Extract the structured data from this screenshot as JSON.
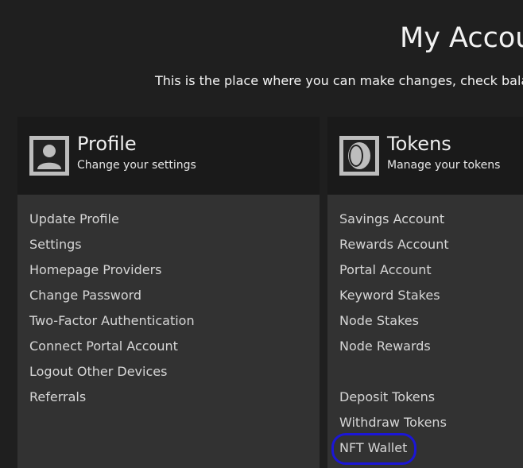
{
  "page": {
    "title": "My Account",
    "subtitle": "This is the place where you can make changes, check balances"
  },
  "profile_card": {
    "icon": "user-icon",
    "title": "Profile",
    "subtitle": "Change your settings",
    "links": [
      {
        "label": "Update Profile"
      },
      {
        "label": "Settings"
      },
      {
        "label": "Homepage Providers"
      },
      {
        "label": "Change Password"
      },
      {
        "label": "Two-Factor Authentication"
      },
      {
        "label": "Connect Portal Account"
      },
      {
        "label": "Logout Other Devices"
      },
      {
        "label": "Referrals"
      }
    ]
  },
  "tokens_card": {
    "icon": "token-icon",
    "title": "Tokens",
    "subtitle": "Manage your tokens",
    "links": [
      {
        "label": "Savings Account"
      },
      {
        "label": "Rewards Account"
      },
      {
        "label": "Portal Account"
      },
      {
        "label": "Keyword Stakes"
      },
      {
        "label": "Node Stakes"
      },
      {
        "label": "Node Rewards"
      },
      {
        "label": "Deposit Tokens"
      },
      {
        "label": "Withdraw Tokens"
      },
      {
        "label": "NFT Wallet"
      }
    ]
  },
  "colors": {
    "background": "#1f1f1f",
    "card_body": "#323232",
    "card_header": "#1a1a1a",
    "highlight": "#1b16d6"
  }
}
